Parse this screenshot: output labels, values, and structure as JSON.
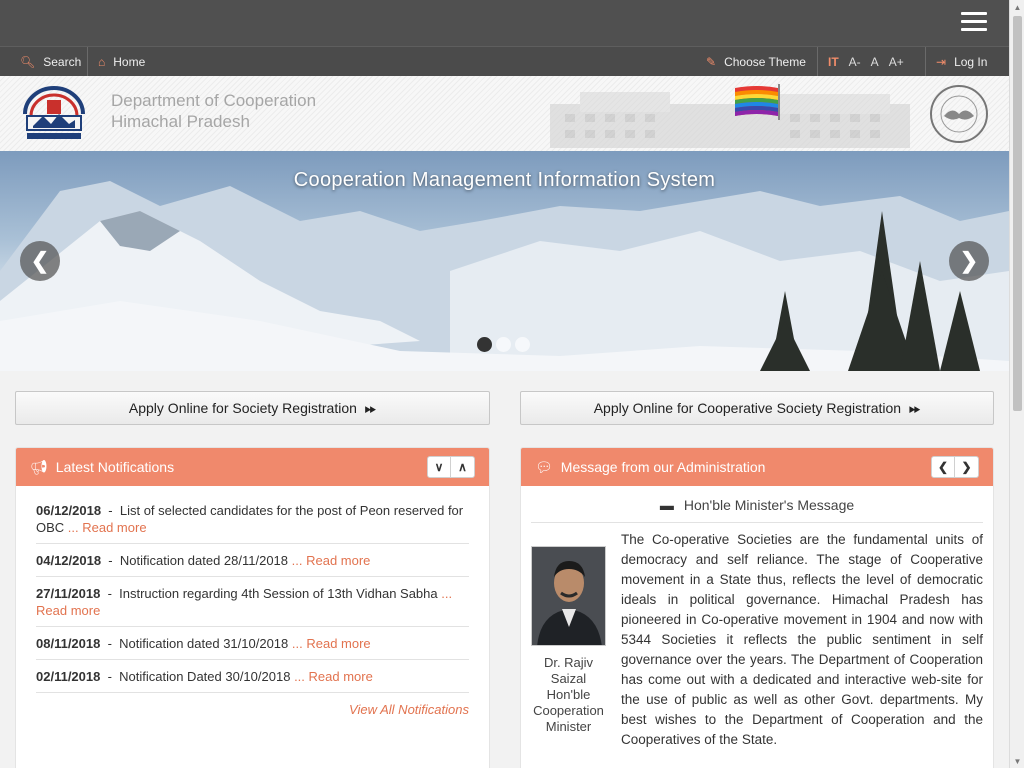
{
  "utility": {
    "search_label": "Search",
    "home_label": "Home",
    "theme_label": "Choose Theme",
    "font_decrease": "A-",
    "font_normal": "A",
    "font_increase": "A+",
    "login_label": "Log In"
  },
  "header": {
    "dept_line1": "Department of Cooperation",
    "dept_line2": "Himachal Pradesh"
  },
  "hero": {
    "title": "Cooperation Management Information System",
    "prev_icon": "chevron-left-icon",
    "next_icon": "chevron-right-icon",
    "active_slide": 1,
    "slide_count": 3
  },
  "apply": {
    "society": "Apply Online for Society Registration",
    "cooperative": "Apply Online for Cooperative Society Registration"
  },
  "notifications": {
    "title": "Latest Notifications",
    "items": [
      {
        "date": "06/12/2018",
        "text": "List of selected candidates for the post of Peon reserved for OBC",
        "more": "... Read more"
      },
      {
        "date": "04/12/2018",
        "text": "Notification dated 28/11/2018",
        "more": "... Read more"
      },
      {
        "date": "27/11/2018",
        "text": "Instruction regarding 4th Session of 13th Vidhan Sabha",
        "more": "... Read more"
      },
      {
        "date": "08/11/2018",
        "text": "Notification dated 31/10/2018",
        "more": "... Read more"
      },
      {
        "date": "02/11/2018",
        "text": "Notification Dated 30/10/2018",
        "more": "... Read more"
      }
    ],
    "view_all": "View All Notifications"
  },
  "message": {
    "title": "Message from our Administration",
    "subtitle": "Hon'ble Minister's Message",
    "name_line1": "Dr. Rajiv",
    "name_line2": "Saizal",
    "role_line1": "Hon'ble",
    "role_line2": "Cooperation",
    "role_line3": "Minister",
    "body": "The Co-operative Societies are the fundamental units of democracy and self reliance. The stage of Cooperative movement in a State thus, reflects the level of democratic ideals in political governance. Himachal Pradesh has pioneered in Co-operative movement in 1904 and now with 5344 Societies it reflects the public sentiment in self governance over the years. The Department of Cooperation has come out with a dedicated and interactive web-site for the use of public as well as other Govt. departments. My best wishes to the Department of Cooperation and the Cooperatives of the State."
  },
  "colors": {
    "accent": "#f0896c",
    "topbar": "#505050",
    "link": "#e2734f"
  }
}
